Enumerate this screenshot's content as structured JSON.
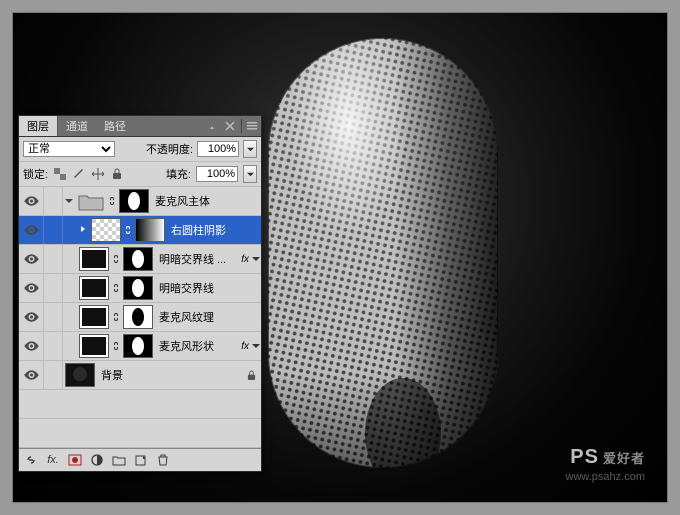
{
  "panel": {
    "tabs": [
      "图层",
      "通道",
      "路径"
    ],
    "active_tab": 0,
    "blend_mode_label": "正常",
    "opacity_label": "不透明度:",
    "opacity_value": "100%",
    "lock_label": "锁定:",
    "fill_label": "填充:",
    "fill_value": "100%"
  },
  "layers": [
    {
      "id": "group",
      "name": "麦克风主体",
      "visible": true,
      "indent": 0,
      "type": "group",
      "mask": "oval",
      "expanded": true
    },
    {
      "id": "shadow",
      "name": "右圆柱阴影",
      "visible": true,
      "indent": 1,
      "type": "layer",
      "selected": true,
      "thumb": "checker",
      "mask": "hgrad",
      "grouped": true
    },
    {
      "id": "boundary2",
      "name": "明暗交界线 ...",
      "visible": true,
      "indent": 1,
      "type": "layer",
      "thumb": "frame",
      "mask": "oval",
      "fx": true
    },
    {
      "id": "boundary1",
      "name": "明暗交界线",
      "visible": true,
      "indent": 1,
      "type": "layer",
      "thumb": "frame",
      "mask": "oval"
    },
    {
      "id": "texture",
      "name": "麦克风纹理",
      "visible": true,
      "indent": 1,
      "type": "layer",
      "thumb": "frame",
      "mask": "ovalB"
    },
    {
      "id": "shape",
      "name": "麦克风形状",
      "visible": true,
      "indent": 1,
      "type": "layer",
      "thumb": "frame",
      "mask": "oval",
      "fx": true
    },
    {
      "id": "bg",
      "name": "背景",
      "visible": true,
      "indent": 0,
      "type": "bg",
      "thumb": "dark",
      "locked": true
    }
  ],
  "watermark": {
    "logo_p": "PS",
    "logo_s": "",
    "tag": "爱好者",
    "url": "www.psahz.com"
  }
}
